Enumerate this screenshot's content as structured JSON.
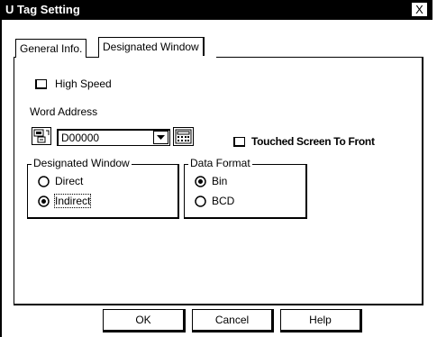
{
  "window": {
    "title": "U Tag Setting",
    "close_glyph": "X"
  },
  "tabs": [
    {
      "label": "General Info."
    },
    {
      "label": "Designated Window"
    }
  ],
  "high_speed": {
    "label": "High Speed",
    "checked": false
  },
  "word_address": {
    "label": "Word Address",
    "value": "D00000"
  },
  "touched_screen": {
    "label": "Touched Screen To Front",
    "checked": false
  },
  "designated_window_group": {
    "legend": "Designated Window",
    "options": [
      {
        "label": "Direct",
        "selected": false
      },
      {
        "label": "Indirect",
        "selected": true
      }
    ]
  },
  "data_format_group": {
    "legend": "Data Format",
    "options": [
      {
        "label": "Bin",
        "selected": true
      },
      {
        "label": "BCD",
        "selected": false
      }
    ]
  },
  "buttons": {
    "ok": "OK",
    "cancel": "Cancel",
    "help": "Help"
  }
}
